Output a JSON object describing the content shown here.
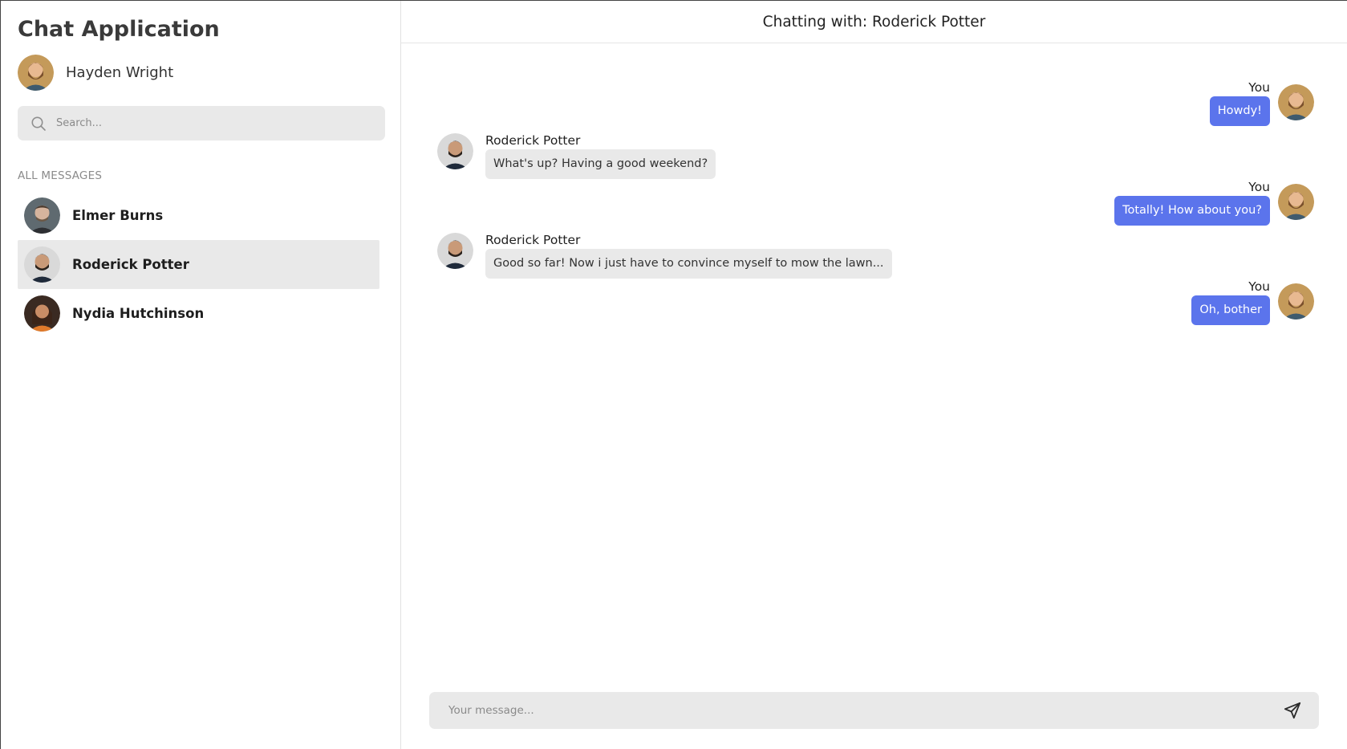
{
  "app": {
    "title": "Chat Application",
    "current_user": {
      "name": "Hayden Wright",
      "avatar": "avatar-icon"
    }
  },
  "search": {
    "placeholder": "Search...",
    "value": ""
  },
  "sidebar": {
    "section_label": "ALL MESSAGES",
    "conversations": [
      {
        "name": "Elmer Burns",
        "active": false
      },
      {
        "name": "Roderick Potter",
        "active": true
      },
      {
        "name": "Nydia Hutchinson",
        "active": false
      }
    ]
  },
  "chat": {
    "header": "Chatting with: Roderick Potter",
    "messages": [
      {
        "direction": "out",
        "sender": "You",
        "text": "Howdy!"
      },
      {
        "direction": "in",
        "sender": "Roderick Potter",
        "text": "What's up? Having a good weekend?"
      },
      {
        "direction": "out",
        "sender": "You",
        "text": "Totally! How about you?"
      },
      {
        "direction": "in",
        "sender": "Roderick Potter",
        "text": "Good so far! Now i just have to convince myself to mow the lawn..."
      },
      {
        "direction": "out",
        "sender": "You",
        "text": "Oh, bother"
      }
    ],
    "composer": {
      "placeholder": "Your message...",
      "value": ""
    }
  },
  "colors": {
    "accent": "#5b74ec",
    "surface": "#e9e9e9",
    "text": "#222222"
  }
}
